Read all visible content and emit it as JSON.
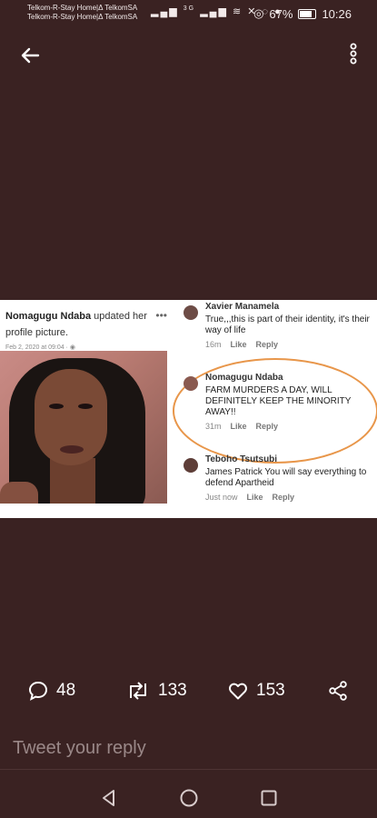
{
  "status_bar": {
    "carrier_line1": "Telkom-R-Stay Home|Δ TelkomSA",
    "carrier_line2": "Telkom-R-Stay Home|Δ TelkomSA",
    "network": "3G",
    "battery": "67%",
    "time": "10:26"
  },
  "tweet_image": {
    "post": {
      "name": "Nomagugu Ndaba",
      "action": " updated her profile picture.",
      "date": "Feb 2, 2020 at 09:04 · "
    },
    "comments": [
      {
        "name": "Xavier Manamela",
        "text": "True,,,this is part of their identity, it's their way of life",
        "time": "16m",
        "like": "Like",
        "reply": "Reply"
      },
      {
        "name": "Nomagugu Ndaba",
        "text": "FARM MURDERS A DAY, WILL DEFINITELY KEEP THE MINORITY AWAY!!",
        "time": "31m",
        "like": "Like",
        "reply": "Reply"
      },
      {
        "name": "Teboho Tsutsubi",
        "text": "James Patrick You will say everything to defend Apartheid",
        "time": "Just now",
        "like": "Like",
        "reply": "Reply"
      }
    ]
  },
  "engagement": {
    "replies": "48",
    "retweets": "133",
    "likes": "153"
  },
  "reply": {
    "placeholder": "Tweet your reply"
  },
  "colors": {
    "background": "#3a2222",
    "highlight": "#e8964a"
  }
}
